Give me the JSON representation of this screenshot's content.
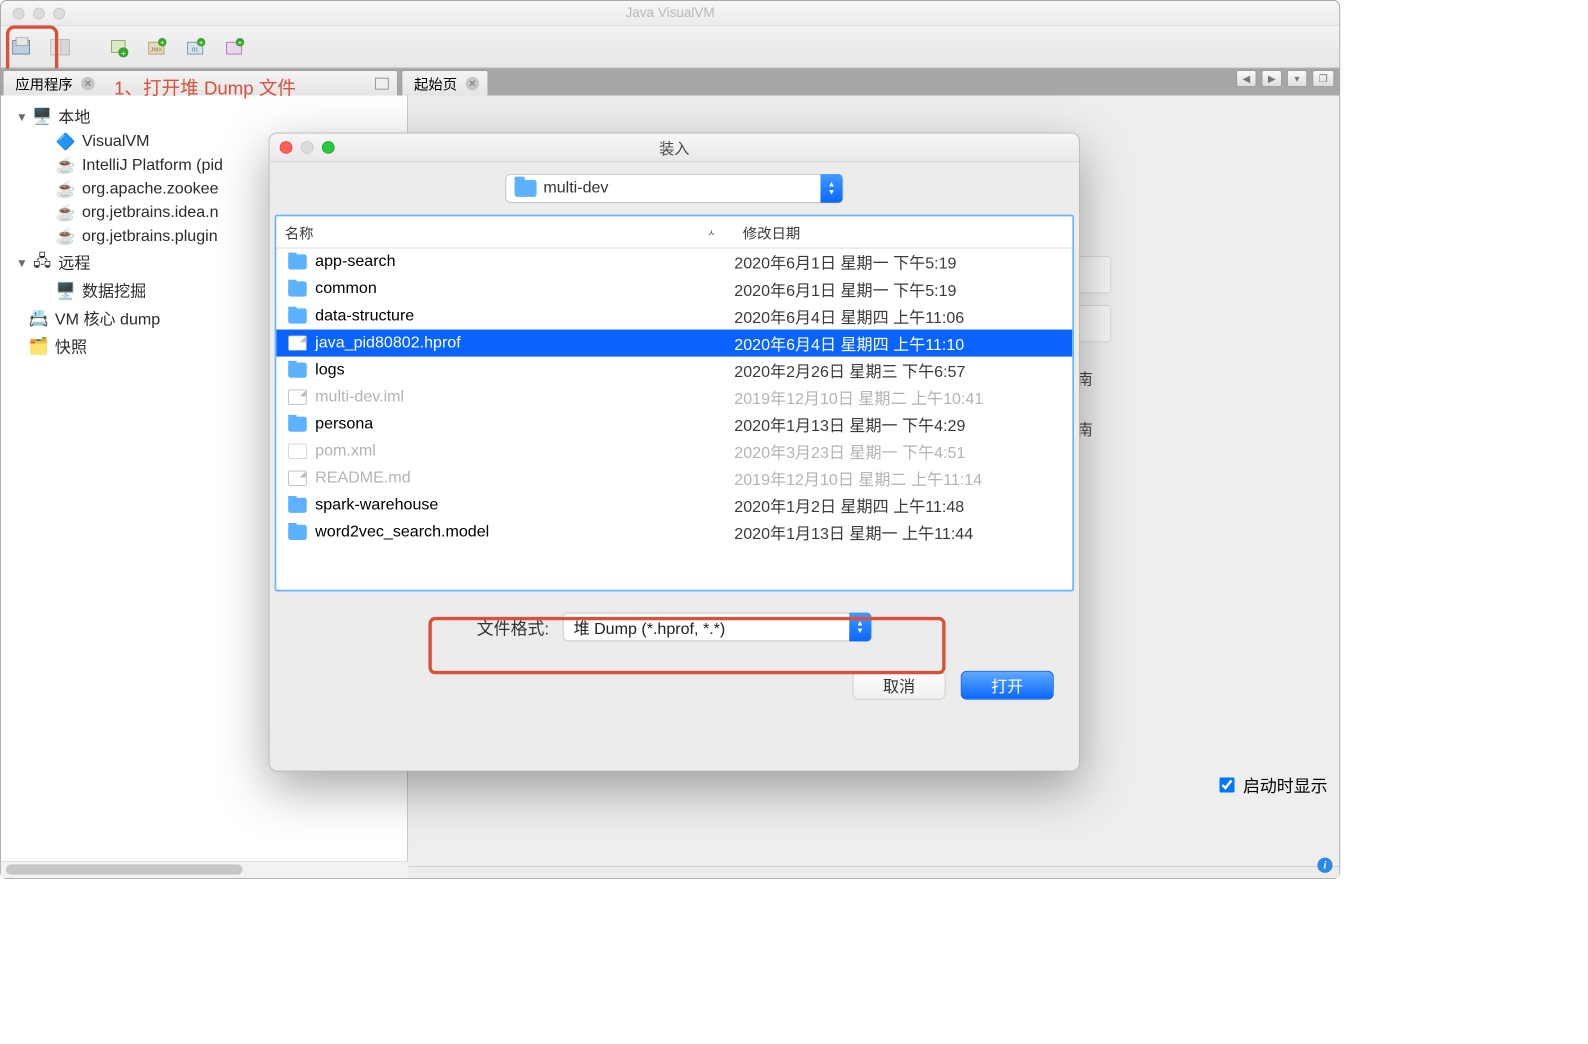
{
  "window": {
    "title": "Java VisualVM"
  },
  "tabs": {
    "apps": "应用程序",
    "start": "起始页"
  },
  "annotation": "1、打开堆 Dump 文件",
  "tree": {
    "local": "本地",
    "items_local": [
      "VisualVM",
      "IntelliJ Platform (pid",
      "org.apache.zookee",
      "org.jetbrains.idea.n",
      "org.jetbrains.plugin"
    ],
    "remote": "远程",
    "remote_items": [
      "数据挖掘"
    ],
    "coredump": "VM 核心 dump",
    "snapshot": "快照"
  },
  "start_peek": {
    "l1": "南",
    "l2": "南"
  },
  "startup_checkbox": "启动时显示",
  "dialog": {
    "title": "装入",
    "folder": "multi-dev",
    "col_name": "名称",
    "col_date": "修改日期",
    "rows": [
      {
        "type": "folder",
        "name": "app-search",
        "date": "2020年6月1日 星期一 下午5:19",
        "dim": false,
        "sel": false
      },
      {
        "type": "folder",
        "name": "common",
        "date": "2020年6月1日 星期一 下午5:19",
        "dim": false,
        "sel": false
      },
      {
        "type": "folder",
        "name": "data-structure",
        "date": "2020年6月4日 星期四 上午11:06",
        "dim": false,
        "sel": false
      },
      {
        "type": "file",
        "name": "java_pid80802.hprof",
        "date": "2020年6月4日 星期四 上午11:10",
        "dim": false,
        "sel": true
      },
      {
        "type": "folder",
        "name": "logs",
        "date": "2020年2月26日 星期三 下午6:57",
        "dim": false,
        "sel": false
      },
      {
        "type": "file",
        "name": "multi-dev.iml",
        "date": "2019年12月10日 星期二 上午10:41",
        "dim": true,
        "sel": false
      },
      {
        "type": "folder",
        "name": "persona",
        "date": "2020年1月13日 星期一 下午4:29",
        "dim": false,
        "sel": false
      },
      {
        "type": "xml",
        "name": "pom.xml",
        "date": "2020年3月23日 星期一 下午4:51",
        "dim": true,
        "sel": false
      },
      {
        "type": "file",
        "name": "README.md",
        "date": "2019年12月10日 星期二 上午11:14",
        "dim": true,
        "sel": false
      },
      {
        "type": "folder",
        "name": "spark-warehouse",
        "date": "2020年1月2日 星期四 上午11:48",
        "dim": false,
        "sel": false
      },
      {
        "type": "folder",
        "name": "word2vec_search.model",
        "date": "2020年1月13日 星期一 上午11:44",
        "dim": false,
        "sel": false
      }
    ],
    "format_label": "文件格式:",
    "format_value": "堆 Dump (*.hprof, *.*)",
    "cancel": "取消",
    "open": "打开"
  }
}
